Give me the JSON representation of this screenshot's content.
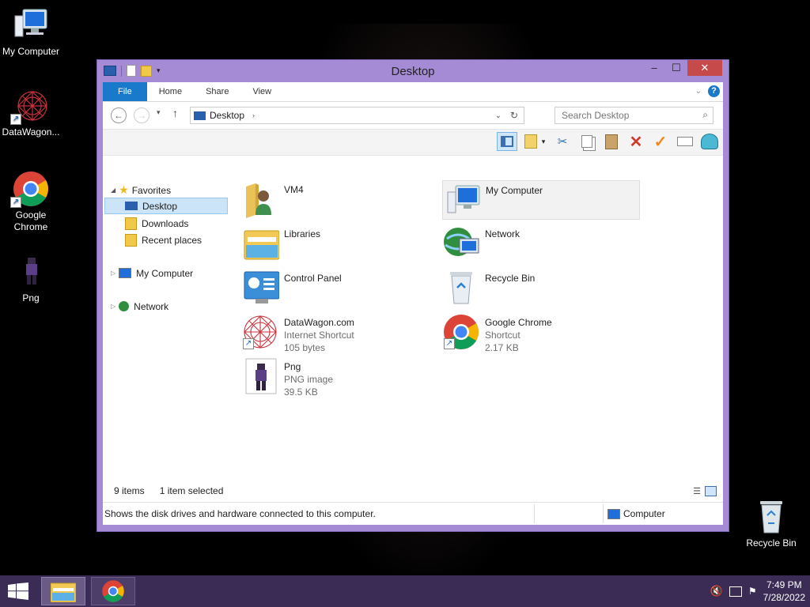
{
  "desktop": {
    "icons": [
      {
        "label": "My Computer",
        "icon": "computer-icon"
      },
      {
        "label": "DataWagon...",
        "icon": "datawagon-icon"
      },
      {
        "label": "Google Chrome",
        "icon": "chrome-icon"
      },
      {
        "label": "Png",
        "icon": "png-image-icon"
      },
      {
        "label": "Recycle Bin",
        "icon": "recycle-bin-icon"
      }
    ]
  },
  "window": {
    "title": "Desktop",
    "controls": {
      "minimize": "–",
      "maximize": "☐",
      "close": "✕"
    },
    "ribbon_tabs": [
      "File",
      "Home",
      "Share",
      "View"
    ],
    "address": {
      "location": "Desktop"
    },
    "search": {
      "placeholder": "Search Desktop"
    },
    "nav_pane": {
      "favorites": "Favorites",
      "desktop": "Desktop",
      "downloads": "Downloads",
      "recent_places": "Recent places",
      "my_computer": "My Computer",
      "network": "Network"
    },
    "items": [
      {
        "name": "VM4",
        "line2": "",
        "line3": "",
        "icon": "user-folder-icon"
      },
      {
        "name": "My Computer",
        "line2": "",
        "line3": "",
        "icon": "computer-icon",
        "selected": true
      },
      {
        "name": "Libraries",
        "line2": "",
        "line3": "",
        "icon": "libraries-icon"
      },
      {
        "name": "Network",
        "line2": "",
        "line3": "",
        "icon": "network-icon"
      },
      {
        "name": "Control Panel",
        "line2": "",
        "line3": "",
        "icon": "control-panel-icon"
      },
      {
        "name": "Recycle Bin",
        "line2": "",
        "line3": "",
        "icon": "recycle-bin-icon"
      },
      {
        "name": "DataWagon.com",
        "line2": "Internet Shortcut",
        "line3": "105 bytes",
        "icon": "datawagon-icon"
      },
      {
        "name": "Google Chrome",
        "line2": "Shortcut",
        "line3": "2.17 KB",
        "icon": "chrome-icon"
      },
      {
        "name": "Png",
        "line2": "PNG image",
        "line3": "39.5 KB",
        "icon": "png-image-icon"
      }
    ],
    "status": {
      "count": "9 items",
      "selection": "1 item selected"
    },
    "details": {
      "description": "Shows the disk drives and hardware connected to this computer.",
      "location": "Computer"
    }
  },
  "taskbar": {
    "time": "7:49 PM",
    "date": "7/28/2022"
  },
  "colors": {
    "window_frame": "#a58bd6",
    "taskbar": "#3a2c54",
    "file_tab": "#1979ca",
    "selection": "#cce4f7"
  }
}
